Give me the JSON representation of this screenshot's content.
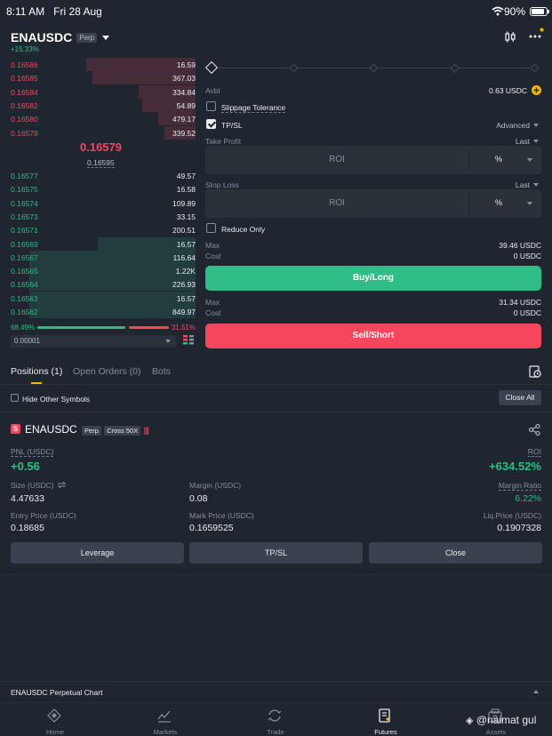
{
  "status_bar": {
    "time": "8:11 AM",
    "date": "Fri 28 Aug",
    "battery": "90%",
    "battery_level": 0.9
  },
  "header": {
    "symbol": "ENAUSDC",
    "badge": "Perp",
    "change": "+15.33%"
  },
  "order_book": {
    "asks": [
      {
        "price": "0.16586",
        "qty": "16.59",
        "depth": 0.59
      },
      {
        "price": "0.16585",
        "qty": "367.03",
        "depth": 0.56
      },
      {
        "price": "0.16584",
        "qty": "334.84",
        "depth": 0.31
      },
      {
        "price": "0.16582",
        "qty": "54.89",
        "depth": 0.29
      },
      {
        "price": "0.16580",
        "qty": "479.17",
        "depth": 0.2
      },
      {
        "price": "0.16578",
        "qty": "339.52",
        "depth": 0.17
      }
    ],
    "last_price": "0.16579",
    "mark_price": "0.16595",
    "bids": [
      {
        "price": "0.16577",
        "qty": "49.57",
        "depth": 0.0
      },
      {
        "price": "0.16575",
        "qty": "16.58",
        "depth": 0.0
      },
      {
        "price": "0.16574",
        "qty": "109.89",
        "depth": 0.0
      },
      {
        "price": "0.16573",
        "qty": "33.15",
        "depth": 0.0
      },
      {
        "price": "0.16571",
        "qty": "200.51",
        "depth": 0.0
      },
      {
        "price": "0.16569",
        "qty": "16.57",
        "depth": 0.53
      },
      {
        "price": "0.16567",
        "qty": "116.64",
        "depth": 0.9
      },
      {
        "price": "0.16565",
        "qty": "1.22K",
        "depth": 0.9
      },
      {
        "price": "0.16564",
        "qty": "226.93",
        "depth": 0.9
      },
      {
        "price": "0.16563",
        "qty": "16.57",
        "depth": 0.9
      },
      {
        "price": "0.16562",
        "qty": "849.97",
        "depth": 0.9
      }
    ],
    "buy_ratio": "68.49%",
    "sell_ratio": "31.51%",
    "buy_ratio_value": 0.6849,
    "precision": "0.00001"
  },
  "order_form": {
    "avbl_label": "Avbl",
    "avbl_value": "0.63 USDC",
    "slippage_label": "Slippage Tolerance",
    "tpsl_label": "TP/SL",
    "advanced_label": "Advanced",
    "take_profit_label": "Take Profit",
    "take_profit_trigger": "Last",
    "take_profit_placeholder": "ROI",
    "take_profit_unit": "%",
    "stop_loss_label": "Stop Loss",
    "stop_loss_trigger": "Last",
    "stop_loss_placeholder": "ROI",
    "stop_loss_unit": "%",
    "reduce_only_label": "Reduce Only",
    "buy_max_label": "Max",
    "buy_max_value": "39.46 USDC",
    "buy_cost_label": "Cost",
    "buy_cost_value": "0 USDC",
    "buy_button": "Buy/Long",
    "sell_max_label": "Max",
    "sell_max_value": "31.34 USDC",
    "sell_cost_label": "Cost",
    "sell_cost_value": "0 USDC",
    "sell_button": "Sell/Short"
  },
  "tabs": {
    "positions": "Positions (1)",
    "open_orders": "Open Orders (0)",
    "bots": "Bots"
  },
  "positions_bar": {
    "hide_label": "Hide Other Symbols",
    "close_all": "Close All"
  },
  "position": {
    "side_letter": "S",
    "symbol": "ENAUSDC",
    "tag_perp": "Perp",
    "tag_margin": "Cross 50X",
    "pnl_label": "PNL (USDC)",
    "pnl_value": "+0.56",
    "roi_label": "ROI",
    "roi_value": "+634.52%",
    "size_label": "Size (USDC)",
    "size_value": "4.47633",
    "margin_label": "Margin (USDC)",
    "margin_value": "0.08",
    "margin_ratio_label": "Margin Ratio",
    "margin_ratio_value": "6.22%",
    "entry_label": "Entry Price (USDC)",
    "entry_value": "0.18685",
    "mark_label": "Mark Price (USDC)",
    "mark_value": "0.1659525",
    "liq_label": "Liq.Price (USDC)",
    "liq_value": "0.1907328",
    "leverage_btn": "Leverage",
    "tpsl_btn": "TP/SL",
    "close_btn": "Close"
  },
  "chart_bar": {
    "title": "ENAUSDC Perpetual Chart"
  },
  "nav": {
    "home": "Home",
    "markets": "Markets",
    "trade": "Trade",
    "futures": "Futures",
    "assets": "Assets"
  },
  "watermark": "@naimat gul",
  "colors": {
    "green": "#2ebd85",
    "red": "#f6465d",
    "yellow": "#f0b90b",
    "bg": "#1f2630",
    "panel": "#2b3139"
  },
  "icons": [
    "wifi-icon",
    "battery-icon",
    "dropdown-icon",
    "candlestick-icon",
    "more-icon",
    "calendar-clock-icon",
    "share-icon",
    "swap-icon",
    "home-icon",
    "markets-icon",
    "trade-icon",
    "futures-icon",
    "assets-icon",
    "order-book-layout-icon"
  ]
}
